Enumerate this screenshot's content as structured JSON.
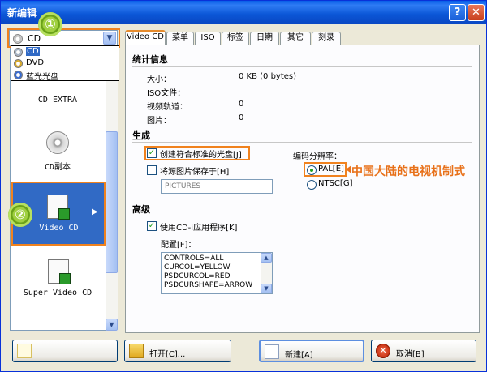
{
  "window": {
    "title": "新编辑",
    "help_glyph": "?",
    "close_glyph": "✕"
  },
  "disc_combo": {
    "value": "CD",
    "options": [
      "CD",
      "DVD",
      "蓝光光盘"
    ],
    "arrow_glyph": "▼"
  },
  "left_list": {
    "items": [
      {
        "label": "CD EXTRA"
      },
      {
        "label": "CD副本"
      },
      {
        "label": "Video CD"
      },
      {
        "label": "Super Video CD"
      }
    ],
    "scroll_up": "▲",
    "scroll_down": "▼",
    "selected_arrow": "▶"
  },
  "badges": {
    "one": "①",
    "two": "②"
  },
  "tabs": [
    "Video CD",
    "菜单",
    "ISO",
    "标签",
    "日期",
    "其它",
    "刻录"
  ],
  "stats": {
    "title": "统计信息",
    "rows": [
      {
        "label": "大小：",
        "value": "0 KB (0 bytes)"
      },
      {
        "label": "ISO文件：",
        "value": ""
      },
      {
        "label": "视频轨道：",
        "value": "0"
      },
      {
        "label": "图片：",
        "value": "0"
      }
    ]
  },
  "generate": {
    "title": "生成",
    "standard_disc_label": "创建符合标准的光盘[J]",
    "standard_disc_checked": true,
    "save_images_label": "将源图片保存于[H]",
    "save_images_checked": false,
    "pictures_field": "PICTURES",
    "resolution_label": "编码分辨率：",
    "pal_label": "PAL[E]",
    "ntsc_label": "NTSC[G]",
    "selected": "PAL",
    "annotation": "中国大陆的电视机制式"
  },
  "advanced": {
    "title": "高级",
    "cdi_label": "使用CD-i应用程序[K]",
    "cdi_checked": true,
    "config_label": "配置[F]：",
    "config_lines": [
      "CONTROLS=ALL",
      "CURCOL=YELLOW",
      "PSDCURCOL=RED",
      "PSDCURSHAPE=ARROW"
    ]
  },
  "buttons": {
    "open": "打开[C]...",
    "new": "新建[A]",
    "cancel": "取消[B]"
  }
}
